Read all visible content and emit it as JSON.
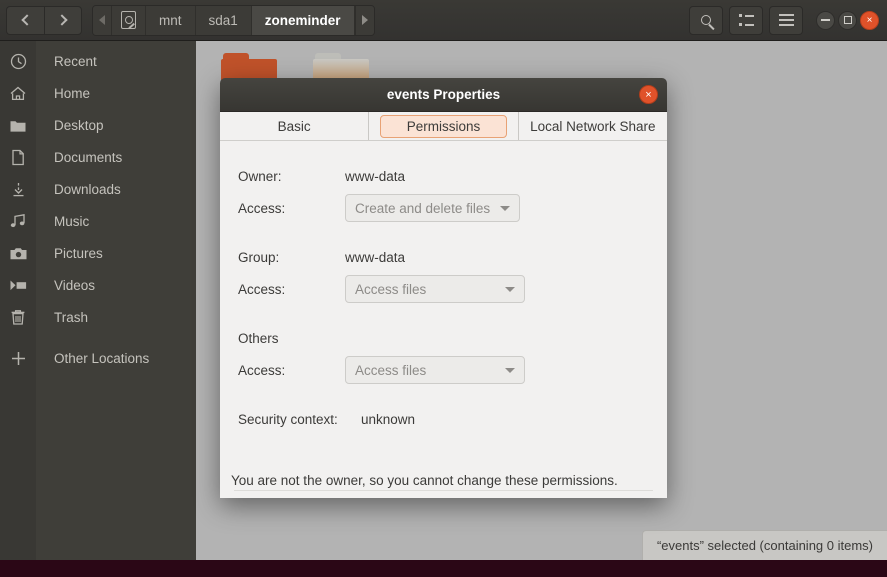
{
  "window": {
    "nav": {
      "back": "back-arrow",
      "forward": "forward-arrow"
    },
    "breadcrumbs": [
      {
        "label": "",
        "icon": "drive-icon",
        "active": false
      },
      {
        "label": "mnt",
        "active": false
      },
      {
        "label": "sda1",
        "active": false
      },
      {
        "label": "zoneminder",
        "active": true
      }
    ],
    "toolbar_buttons": [
      {
        "name": "search-button",
        "icon": "search-icon"
      },
      {
        "name": "view-options-button",
        "icon": "list-view-icon"
      },
      {
        "name": "main-menu-button",
        "icon": "hamburger-icon"
      }
    ],
    "controls": {
      "minimize": "–",
      "maximize": "□",
      "close": "×"
    }
  },
  "sidebar": {
    "items": [
      {
        "label": "Recent",
        "icon": "clock-icon"
      },
      {
        "label": "Home",
        "icon": "home-icon"
      },
      {
        "label": "Desktop",
        "icon": "folder-icon"
      },
      {
        "label": "Documents",
        "icon": "document-icon"
      },
      {
        "label": "Downloads",
        "icon": "download-icon"
      },
      {
        "label": "Music",
        "icon": "music-icon"
      },
      {
        "label": "Pictures",
        "icon": "camera-icon"
      },
      {
        "label": "Videos",
        "icon": "video-icon"
      },
      {
        "label": "Trash",
        "icon": "trash-icon"
      },
      {
        "label": "Other Locations",
        "icon": "plus-icon"
      }
    ]
  },
  "statusbar": {
    "text": "“events” selected  (containing 0 items)"
  },
  "dialog": {
    "title": "events Properties",
    "close_label": "×",
    "tabs": [
      {
        "label": "Basic",
        "active": false
      },
      {
        "label": "Permissions",
        "active": true
      },
      {
        "label": "Local Network Share",
        "active": false
      }
    ],
    "fields": {
      "owner_label": "Owner:",
      "owner_value": "www-data",
      "owner_access_label": "Access:",
      "owner_access_value": "Create and delete files",
      "group_label": "Group:",
      "group_value": "www-data",
      "group_access_label": "Access:",
      "group_access_value": "Access files",
      "others_label": "Others",
      "others_access_label": "Access:",
      "others_access_value": "Access files",
      "security_label": "Security context:",
      "security_value": "unknown"
    },
    "footer_note": "You are not the owner, so you cannot change these permissions."
  },
  "colors": {
    "accent": "#e0522a",
    "tab_highlight_bg": "#fbe3d5",
    "tab_highlight_border": "#e8a275",
    "header_bg": "#3a3935",
    "sidebar_bg": "#3f3e39",
    "dialog_bg": "#f2f1f0",
    "main_bg": "#b3b3b3"
  }
}
